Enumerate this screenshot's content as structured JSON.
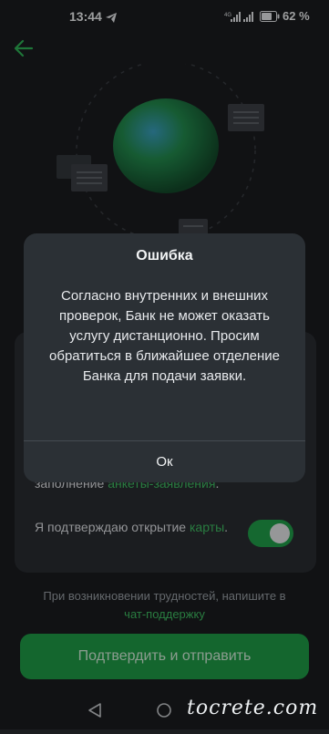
{
  "status_bar": {
    "time": "13:44",
    "network": "4G",
    "battery": "62 %"
  },
  "icons": {
    "back": "arrow-left-icon",
    "telegram": "telegram-icon",
    "signal": "signal-icon",
    "battery": "battery-icon"
  },
  "colors": {
    "accent": "#1f9d47",
    "link": "#3fbf63",
    "background": "#1b1d20",
    "dialog": "#2b3035"
  },
  "form": {
    "terms_prefix": "заполнение ",
    "terms_link": "анкеты-заявления",
    "terms_suffix": ".",
    "confirm_prefix": "Я подтверждаю открытие ",
    "confirm_link": "карты",
    "confirm_suffix": ".",
    "toggle_on": true
  },
  "help": {
    "text": "При возникновении трудностей, напишите в",
    "link": "чат-поддержку"
  },
  "submit_label": "Подтвердить и отправить",
  "dialog": {
    "title": "Ошибка",
    "message": "Согласно внутренних и внешних проверок, Банк не может оказать услугу дистанционно. Просим обратиться в ближайшее отделение Банка для подачи заявки.",
    "ok_label": "Ок"
  },
  "watermark": "tocrete.com"
}
